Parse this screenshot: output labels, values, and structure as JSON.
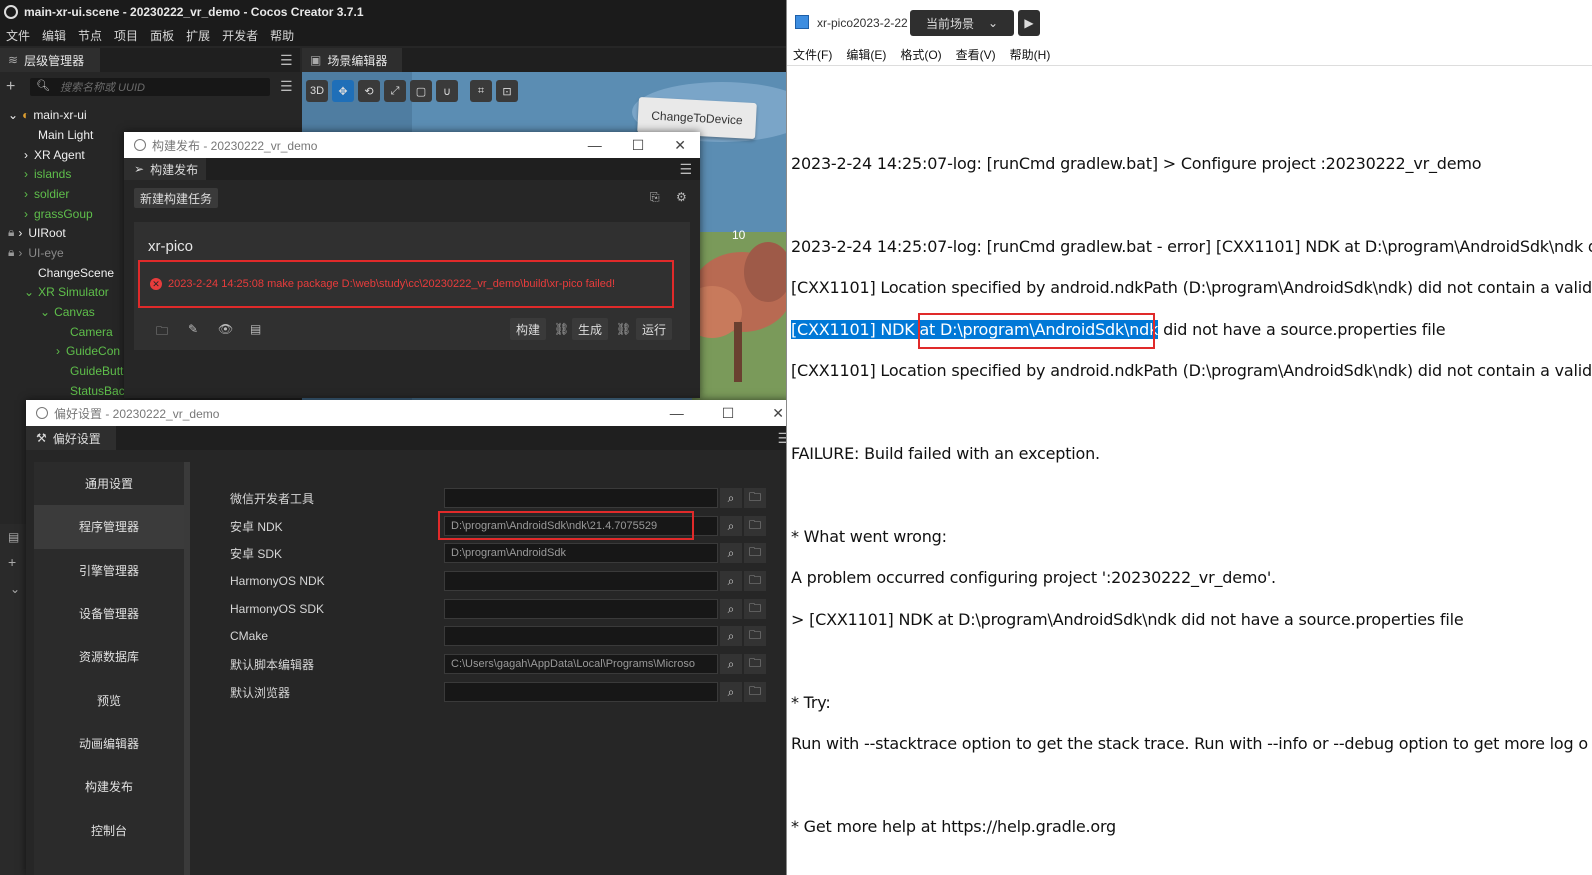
{
  "app": {
    "title": "main-xr-ui.scene - 20230222_vr_demo - Cocos Creator 3.7.1",
    "menu": [
      "文件",
      "编辑",
      "节点",
      "项目",
      "面板",
      "扩展",
      "开发者",
      "帮助"
    ],
    "scene_selector": "当前场景"
  },
  "hierarchy": {
    "tab": "层级管理器",
    "search_placeholder": "搜索名称或 UUID",
    "nodes": [
      {
        "label": "main-xr-ui"
      },
      {
        "label": "Main Light"
      },
      {
        "label": "XR Agent"
      },
      {
        "label": "islands"
      },
      {
        "label": "soldier"
      },
      {
        "label": "grassGoup"
      },
      {
        "label": "UIRoot"
      },
      {
        "label": "UI-eye"
      },
      {
        "label": "ChangeScene"
      },
      {
        "label": "XR Simulator"
      },
      {
        "label": "Canvas"
      },
      {
        "label": "Camera"
      },
      {
        "label": "GuideCon"
      },
      {
        "label": "GuideButt"
      },
      {
        "label": "StatusBac"
      }
    ]
  },
  "scene_editor": {
    "tab": "场景编辑器",
    "mode": "3D",
    "change_button": "ChangeToDevice",
    "counter": "10"
  },
  "build_dialog": {
    "window_title": "构建发布 - 20230222_vr_demo",
    "tab": "构建发布",
    "new_task": "新建构建任务",
    "platform": "xr-pico",
    "error": "2023-2-24 14:25:08 make package D:\\web\\study\\cc\\20230222_vr_demo\\build\\xr-pico failed!",
    "build_btn": "构建",
    "make_btn": "生成",
    "run_btn": "运行"
  },
  "pref_dialog": {
    "window_title": "偏好设置 - 20230222_vr_demo",
    "tab": "偏好设置",
    "nav": [
      "通用设置",
      "程序管理器",
      "引擎管理器",
      "设备管理器",
      "资源数据库",
      "预览",
      "动画编辑器",
      "构建发布",
      "控制台"
    ],
    "fields": [
      {
        "label": "微信开发者工具",
        "value": ""
      },
      {
        "label": "安卓 NDK",
        "value": "D:\\program\\AndroidSdk\\ndk\\21.4.7075529"
      },
      {
        "label": "安卓 SDK",
        "value": "D:\\program\\AndroidSdk"
      },
      {
        "label": "HarmonyOS NDK",
        "value": ""
      },
      {
        "label": "HarmonyOS SDK",
        "value": ""
      },
      {
        "label": "CMake",
        "value": ""
      },
      {
        "label": "默认脚本编辑器",
        "value": "C:\\Users\\gagah\\AppData\\Local\\Programs\\Microso"
      },
      {
        "label": "默认浏览器",
        "value": ""
      }
    ]
  },
  "notepad": {
    "title": "xr-pico2023-2-22 01-48.log - 记事本",
    "menu": [
      "文件(F)",
      "编辑(E)",
      "格式(O)",
      "查看(V)",
      "帮助(H)"
    ],
    "lines": {
      "l1": "2023-2-24 14:25:07-log: [runCmd gradlew.bat] > Configure project :20230222_vr_demo",
      "l2": "2023-2-24 14:25:07-log: [runCmd gradlew.bat - error] [CXX1101] NDK at D:\\program\\AndroidSdk\\ndk di",
      "l3": "[CXX1101] Location specified by android.ndkPath (D:\\program\\AndroidSdk\\ndk) did not contain a valid",
      "l4_sel": "[CXX1101] NDK at D:\\program\\AndroidSdk\\ndk",
      "l4_rest": " did not have a source.properties file",
      "l5": "[CXX1101] Location specified by android.ndkPath (D:\\program\\AndroidSdk\\ndk) did not contain a valid",
      "l6": "FAILURE: Build failed with an exception.",
      "l7": "* What went wrong:",
      "l8": "A problem occurred configuring project ':20230222_vr_demo'.",
      "l9": "> [CXX1101] NDK at D:\\program\\AndroidSdk\\ndk did not have a source.properties file",
      "l10": "* Try:",
      "l11": "Run with --stacktrace option to get the stack trace. Run with --info or --debug option to get more log o",
      "l12": "* Get more help at https://help.gradle.org"
    }
  }
}
